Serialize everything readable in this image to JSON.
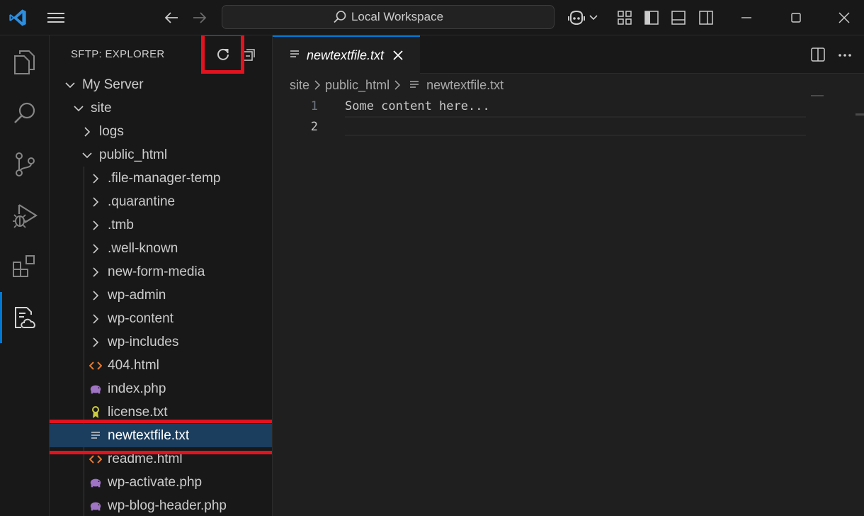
{
  "titlebar": {
    "search_text": "Local Workspace"
  },
  "sidebar": {
    "title": "SFTP: EXPLORER",
    "tree": [
      {
        "label": "My Server",
        "type": "folder-open",
        "depth": 0
      },
      {
        "label": "site",
        "type": "folder-open",
        "depth": 1
      },
      {
        "label": "logs",
        "type": "folder",
        "depth": 2
      },
      {
        "label": "public_html",
        "type": "folder-open",
        "depth": 2
      },
      {
        "label": ".file-manager-temp",
        "type": "folder",
        "depth": 3
      },
      {
        "label": ".quarantine",
        "type": "folder",
        "depth": 3
      },
      {
        "label": ".tmb",
        "type": "folder",
        "depth": 3
      },
      {
        "label": ".well-known",
        "type": "folder",
        "depth": 3
      },
      {
        "label": "new-form-media",
        "type": "folder",
        "depth": 3
      },
      {
        "label": "wp-admin",
        "type": "folder",
        "depth": 3
      },
      {
        "label": "wp-content",
        "type": "folder",
        "depth": 3
      },
      {
        "label": "wp-includes",
        "type": "folder",
        "depth": 3
      },
      {
        "label": "404.html",
        "type": "html",
        "depth": 3
      },
      {
        "label": "index.php",
        "type": "php",
        "depth": 3
      },
      {
        "label": "license.txt",
        "type": "license",
        "depth": 3
      },
      {
        "label": "newtextfile.txt",
        "type": "text",
        "depth": 3,
        "selected": true
      },
      {
        "label": "readme.html",
        "type": "html",
        "depth": 3
      },
      {
        "label": "wp-activate.php",
        "type": "php",
        "depth": 3
      },
      {
        "label": "wp-blog-header.php",
        "type": "php",
        "depth": 3
      }
    ]
  },
  "editor": {
    "tab_label": "newtextfile.txt",
    "breadcrumb": [
      "site",
      "public_html",
      "newtextfile.txt"
    ],
    "lines": [
      {
        "num": "1",
        "text": "Some content here..."
      },
      {
        "num": "2",
        "text": ""
      }
    ]
  },
  "colors": {
    "accent": "#0078d4",
    "highlight": "#e3121f",
    "selection": "#1b3d5e",
    "html_icon": "#e37933",
    "php_icon": "#a074c4",
    "license_icon": "#cbcb41"
  }
}
